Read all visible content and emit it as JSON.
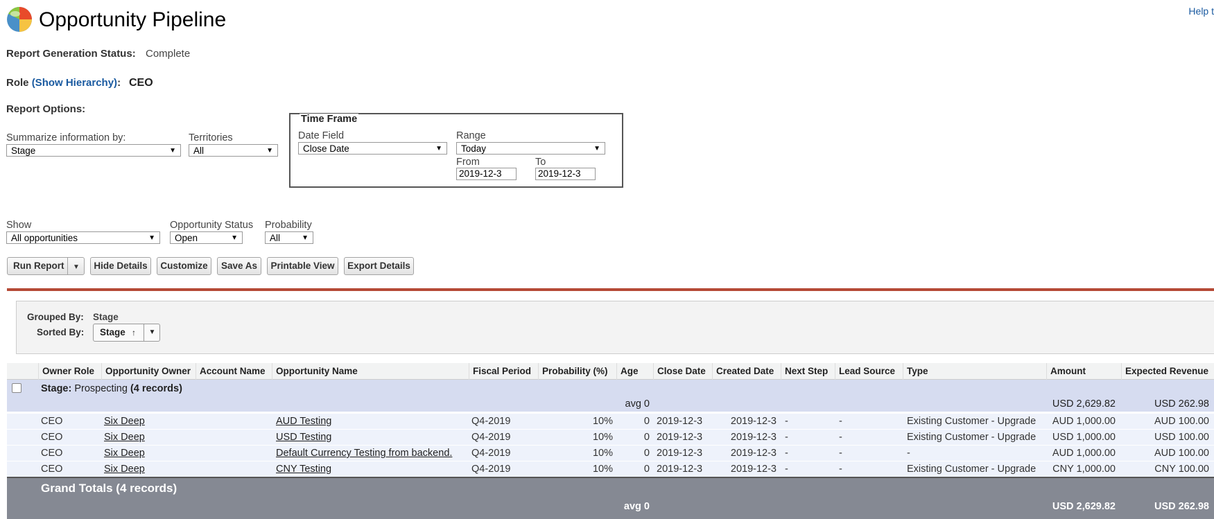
{
  "header": {
    "title": "Opportunity Pipeline",
    "help_link": "Help t"
  },
  "status": {
    "label": "Report Generation Status:",
    "value": "Complete"
  },
  "role": {
    "label": "Role",
    "link": "(Show Hierarchy)",
    "colon": ":",
    "value": "CEO"
  },
  "report_options": {
    "label": "Report Options:",
    "summarize_label": "Summarize information by:",
    "summarize_value": "Stage",
    "territories_label": "Territories",
    "territories_value": "All"
  },
  "time_frame": {
    "legend": "Time Frame",
    "date_field_label": "Date Field",
    "date_field_value": "Close Date",
    "range_label": "Range",
    "range_value": "Today",
    "from_label": "From",
    "from_value": "2019-12-3",
    "to_label": "To",
    "to_value": "2019-12-3"
  },
  "filters": {
    "show_label": "Show",
    "show_value": "All opportunities",
    "opp_status_label": "Opportunity Status",
    "opp_status_value": "Open",
    "probability_label": "Probability",
    "probability_value": "All"
  },
  "buttons": {
    "run_report": "Run Report",
    "hide_details": "Hide Details",
    "customize": "Customize",
    "save_as": "Save As",
    "printable_view": "Printable View",
    "export_details": "Export Details"
  },
  "grouping": {
    "grouped_by_label": "Grouped By:",
    "grouped_by_value": "Stage",
    "sorted_by_label": "Sorted By:",
    "sorted_by_value": "Stage",
    "sort_arrow": "↑"
  },
  "table": {
    "headers": [
      "Owner Role",
      "Opportunity Owner",
      "Account Name",
      "Opportunity Name",
      "Fiscal Period",
      "Probability (%)",
      "Age",
      "Close Date",
      "Created Date",
      "Next Step",
      "Lead Source",
      "Type",
      "Amount",
      "Expected Revenue"
    ],
    "stage_group": {
      "label": "Stage:",
      "name": "Prospecting",
      "count": "(4 records)",
      "avg_age": "avg 0",
      "amount": "USD 2,629.82",
      "expected": "USD 262.98"
    },
    "rows": [
      {
        "owner_role": "CEO",
        "owner": "Six Deep",
        "account": "",
        "opportunity": "AUD Testing",
        "fiscal": "Q4-2019",
        "probability": "10%",
        "age": "0",
        "close_date": "2019-12-3",
        "created_date": "2019-12-3",
        "next_step": "-",
        "lead_source": "-",
        "type": "Existing Customer - Upgrade",
        "amount": "AUD 1,000.00",
        "expected": "AUD 100.00"
      },
      {
        "owner_role": "CEO",
        "owner": "Six Deep",
        "account": "",
        "opportunity": "USD Testing",
        "fiscal": "Q4-2019",
        "probability": "10%",
        "age": "0",
        "close_date": "2019-12-3",
        "created_date": "2019-12-3",
        "next_step": "-",
        "lead_source": "-",
        "type": "Existing Customer - Upgrade",
        "amount": "USD 1,000.00",
        "expected": "USD 100.00"
      },
      {
        "owner_role": "CEO",
        "owner": "Six Deep",
        "account": "",
        "opportunity": "Default Currency Testing from backend.",
        "fiscal": "Q4-2019",
        "probability": "10%",
        "age": "0",
        "close_date": "2019-12-3",
        "created_date": "2019-12-3",
        "next_step": "-",
        "lead_source": "-",
        "type": "-",
        "amount": "AUD 1,000.00",
        "expected": "AUD 100.00"
      },
      {
        "owner_role": "CEO",
        "owner": "Six Deep",
        "account": "",
        "opportunity": "CNY Testing",
        "fiscal": "Q4-2019",
        "probability": "10%",
        "age": "0",
        "close_date": "2019-12-3",
        "created_date": "2019-12-3",
        "next_step": "-",
        "lead_source": "-",
        "type": "Existing Customer - Upgrade",
        "amount": "CNY 1,000.00",
        "expected": "CNY 100.00"
      }
    ],
    "grand_totals": {
      "label": "Grand Totals (4 records)",
      "avg_age": "avg 0",
      "amount": "USD 2,629.82",
      "expected": "USD 262.98"
    }
  }
}
